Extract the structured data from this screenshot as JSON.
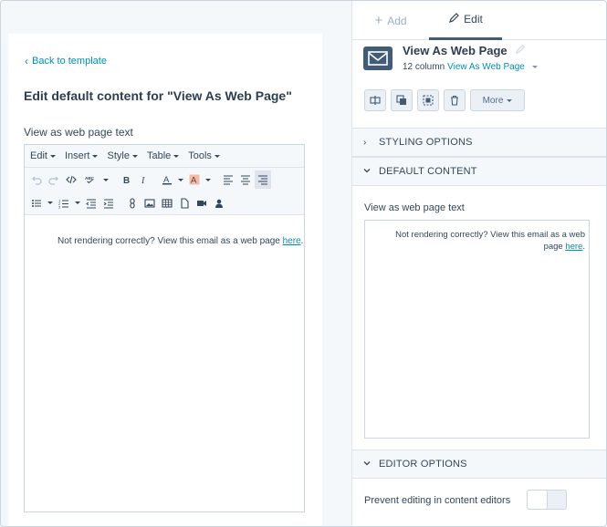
{
  "left": {
    "back_link": "Back to template",
    "heading": "Edit default content for \"View As Web Page\"",
    "field_label": "View as web page text",
    "menubar": [
      "Edit",
      "Insert",
      "Style",
      "Table",
      "Tools"
    ],
    "editor_text": "Not rendering correctly? View this email as a web page ",
    "editor_link": "here",
    "editor_suffix": "."
  },
  "right": {
    "tabs": {
      "add": "Add",
      "edit": "Edit"
    },
    "module": {
      "title": "View As Web Page",
      "columns": "12 column",
      "type_link": "View As Web Page"
    },
    "more_label": "More",
    "sections": {
      "styling": "STYLING OPTIONS",
      "default_content": "DEFAULT CONTENT",
      "editor_options": "EDITOR OPTIONS"
    },
    "text_label": "View as web page text",
    "preview_text": "Not rendering correctly? View this email as a web page ",
    "preview_link": "here",
    "preview_suffix": ".",
    "prevent_label": "Prevent editing in content editors",
    "prevent_enabled": false
  },
  "colors": {
    "accent_link": "#0091ae",
    "heading": "#2d3e50",
    "icon_bg": "#425b76",
    "panel_bg": "#f5f8fa"
  }
}
